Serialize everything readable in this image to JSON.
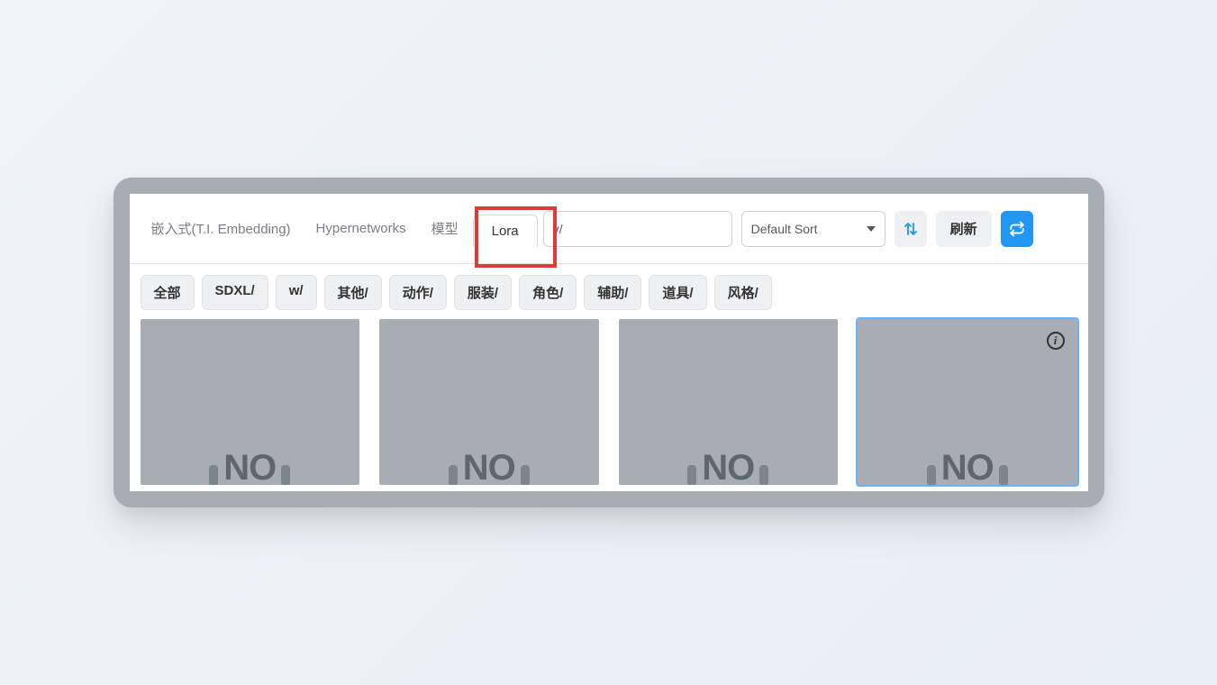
{
  "tabs": [
    {
      "label": "嵌入式(T.I. Embedding)"
    },
    {
      "label": "Hypernetworks"
    },
    {
      "label": "模型"
    },
    {
      "label": "Lora",
      "active": true
    }
  ],
  "search": {
    "value": "v/"
  },
  "sort": {
    "label": "Default Sort"
  },
  "refresh_btn": "刷新",
  "filters": [
    {
      "label": "全部"
    },
    {
      "label": "SDXL/"
    },
    {
      "label": "w/"
    },
    {
      "label": "其他/"
    },
    {
      "label": "动作/"
    },
    {
      "label": "服装/"
    },
    {
      "label": "角色/"
    },
    {
      "label": "辅助/"
    },
    {
      "label": "道具/"
    },
    {
      "label": "风格/"
    }
  ],
  "cards": [
    {
      "placeholder": "NO"
    },
    {
      "placeholder": "NO"
    },
    {
      "placeholder": "NO"
    },
    {
      "placeholder": "NO",
      "selected": true,
      "info": true
    }
  ]
}
